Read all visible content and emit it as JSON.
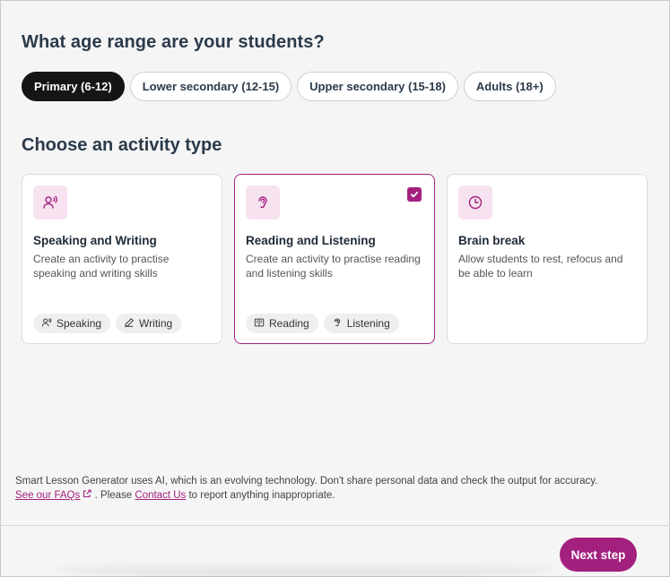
{
  "age_section": {
    "heading": "What age range are your students?",
    "options": [
      {
        "label": "Primary (6-12)",
        "selected": true
      },
      {
        "label": "Lower secondary (12-15)",
        "selected": false
      },
      {
        "label": "Upper secondary (15-18)",
        "selected": false
      },
      {
        "label": "Adults (18+)",
        "selected": false
      }
    ]
  },
  "activity_section": {
    "heading": "Choose an activity type",
    "cards": [
      {
        "icon": "speaking-icon",
        "title": "Speaking and Writing",
        "description": "Create an activity to practise speaking and writing skills",
        "selected": false,
        "tags": [
          {
            "icon": "speaking-icon",
            "label": "Speaking"
          },
          {
            "icon": "pencil-icon",
            "label": "Writing"
          }
        ]
      },
      {
        "icon": "ear-icon",
        "title": "Reading and Listening",
        "description": "Create an activity to practise reading and listening skills",
        "selected": true,
        "tags": [
          {
            "icon": "book-icon",
            "label": "Reading"
          },
          {
            "icon": "ear-icon",
            "label": "Listening"
          }
        ]
      },
      {
        "icon": "clock-icon",
        "title": "Brain break",
        "description": "Allow students to rest, refocus and be able to learn",
        "selected": false,
        "tags": []
      }
    ]
  },
  "disclaimer": {
    "line1": "Smart Lesson Generator uses AI, which is an evolving technology. Don't share personal data and check the output for accuracy.",
    "faq_link": "See our FAQs",
    "middle": ". Please ",
    "contact_link": "Contact Us",
    "end": " to report anything inappropriate."
  },
  "footer": {
    "next_label": "Next step"
  },
  "colors": {
    "accent": "#a3207f",
    "accent_light": "#f7e3f0",
    "selected_pill": "#151515",
    "background": "#f5f5f5"
  }
}
